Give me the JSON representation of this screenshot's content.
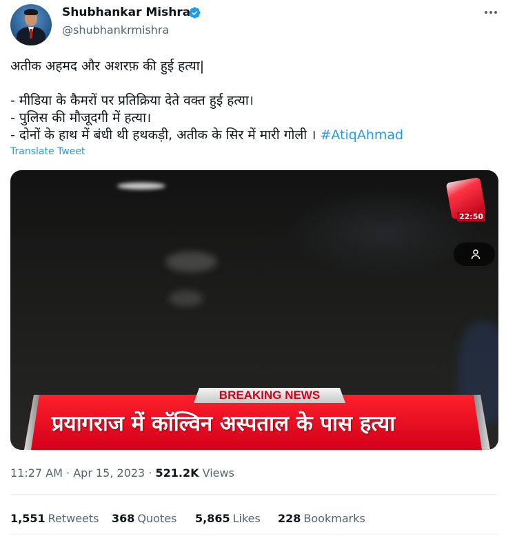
{
  "author": {
    "name": "Shubhankar Mishra",
    "handle": "@shubhankrmishra",
    "verified_color": "#1d9bf0"
  },
  "tweet": {
    "line1": "अतीक अहमद और अशरफ़ की हुई हत्या|",
    "line2": "- मीडिया के कैमरों पर प्रतिक्रिया देते वक्त हुई हत्या।",
    "line3": "- पुलिस की मौजूदगी में हत्या।",
    "line4": "- दोनों के हाथ में बंधी थी हथकड़ी, अतीक के सिर में मारी गोली ।",
    "hashtag": "#AtiqAhmad",
    "translate_label": "Translate Tweet"
  },
  "media": {
    "breaking_label": "BREAKING NEWS",
    "headline": "प्रयागराज में कॉल्विन अस्पताल के पास हत्या",
    "clock": "22:50",
    "accent_color": "#d1001a"
  },
  "meta": {
    "time": "11:27 AM",
    "separator": " · ",
    "date": "Apr 15, 2023",
    "views_count": "521.2K",
    "views_label": "Views"
  },
  "stats": {
    "retweets_count": "1,551",
    "retweets_label": "Retweets",
    "quotes_count": "368",
    "quotes_label": "Quotes",
    "likes_count": "5,865",
    "likes_label": "Likes",
    "bookmarks_count": "228",
    "bookmarks_label": "Bookmarks"
  },
  "icons": {
    "more": "more-horizontal-icon",
    "verified": "verified-badge-icon",
    "viewer": "person-icon"
  }
}
